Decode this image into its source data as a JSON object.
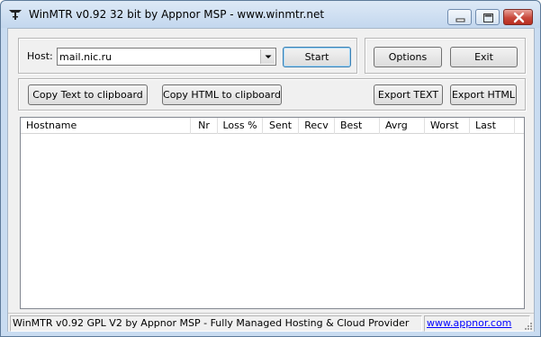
{
  "window": {
    "title": "WinMTR v0.92 32 bit by Appnor MSP - www.winmtr.net"
  },
  "host": {
    "label": "Host:",
    "value": "mail.nic.ru"
  },
  "buttons": {
    "start": "Start",
    "options": "Options",
    "exit": "Exit",
    "copy_text": "Copy Text to clipboard",
    "copy_html": "Copy HTML to clipboard",
    "export_text": "Export TEXT",
    "export_html": "Export HTML"
  },
  "table": {
    "columns": [
      "Hostname",
      "Nr",
      "Loss %",
      "Sent",
      "Recv",
      "Best",
      "Avrg",
      "Worst",
      "Last"
    ],
    "rows": []
  },
  "status": {
    "text": "WinMTR v0.92 GPL V2 by Appnor MSP - Fully Managed Hosting & Cloud Provider",
    "link": "www.appnor.com"
  },
  "colors": {
    "titlebar": "#c9dcf1",
    "close_button": "#c8483b",
    "link": "#0000ff"
  }
}
